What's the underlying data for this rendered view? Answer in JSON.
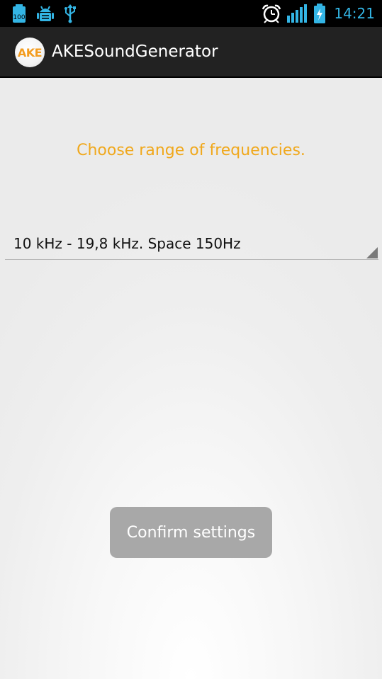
{
  "status_bar": {
    "battery_level_badge": "100",
    "time": "14:21",
    "icons": [
      "battery-100-icon",
      "debug-android-icon",
      "usb-icon",
      "alarm-clock-icon",
      "signal-strength-icon",
      "battery-charging-icon"
    ],
    "accent_color": "#33b5e5"
  },
  "action_bar": {
    "logo_text": "AKE",
    "title": "AKESoundGenerator"
  },
  "main": {
    "prompt": "Choose range of frequencies.",
    "prompt_color": "#f0a81c",
    "frequency_spinner": {
      "selected_value": "10 kHz - 19,8 kHz. Space 150Hz"
    },
    "confirm_button": {
      "label": "Confirm settings",
      "state": "disabled",
      "color": "#a8a8a8"
    }
  }
}
